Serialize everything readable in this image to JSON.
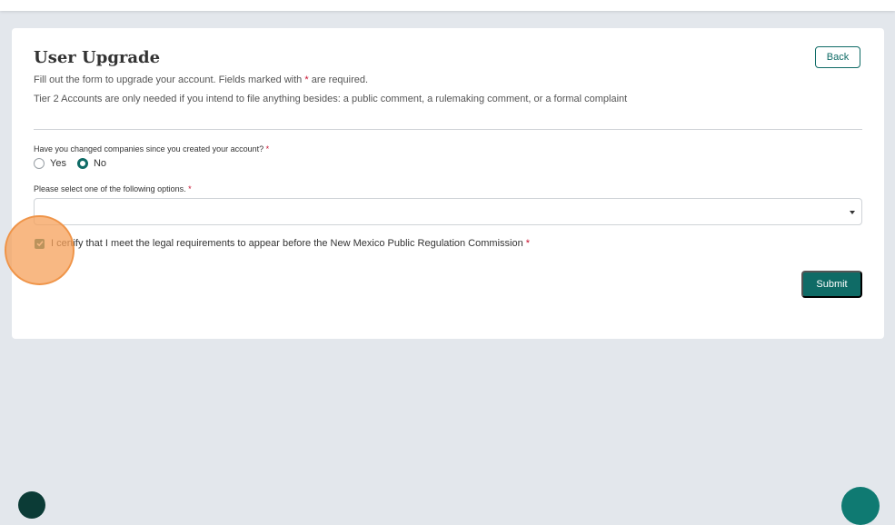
{
  "form": {
    "title": "User Upgrade",
    "back_label": "Back",
    "instructions_prefix": "Fill out the form to upgrade your account. Fields marked with ",
    "required_marker": "*",
    "instructions_suffix": " are required.",
    "tier_note": "Tier 2 Accounts are only needed if you intend to file anything besides: a public comment, a rulemaking comment, or a formal complaint",
    "question_company_change": "Have you changed companies since you created your account?",
    "radio_options": [
      {
        "label": "Yes",
        "checked": false
      },
      {
        "label": "No",
        "checked": true
      }
    ],
    "question_options": "Please select one of the following options.",
    "select_value": "",
    "certify_label": "I certify that I meet the legal requirements to appear before the New Mexico Public Regulation Commission",
    "certify_checked": true,
    "submit_label": "Submit"
  },
  "colors": {
    "accent": "#0f6b66",
    "required": "#c8102e",
    "background": "#e3e7ec",
    "click_marker": "#f5a05a"
  },
  "icons": {
    "dropdown": "caret-down-icon",
    "checkbox": "check-icon",
    "info": "info-icon"
  }
}
